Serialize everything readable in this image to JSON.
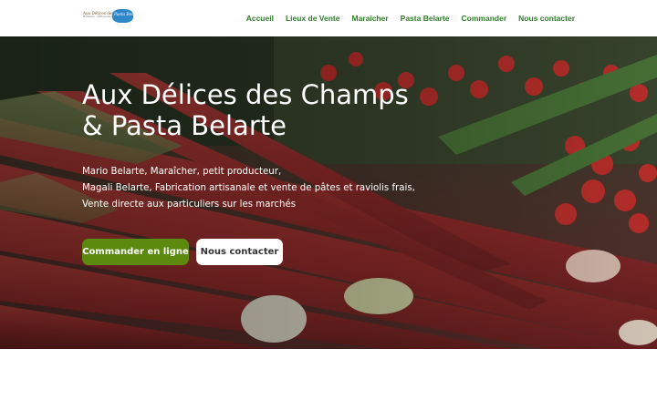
{
  "logo": {
    "line1": "Aux Délices des Champs",
    "line2": "Maraîcher – Petit producteur",
    "badge": "Pasta Belarte"
  },
  "nav": {
    "items": [
      {
        "label": "Accueil"
      },
      {
        "label": "Lieux de Vente"
      },
      {
        "label": "Maraîcher"
      },
      {
        "label": "Pasta Belarte"
      },
      {
        "label": "Commander"
      },
      {
        "label": "Nous contacter"
      }
    ]
  },
  "hero": {
    "title_line1": "Aux Délices des Champs",
    "title_line2": "& Pasta Belarte",
    "desc_line1": "Mario Belarte, Maraîcher, petit producteur,",
    "desc_line2": "Magali Belarte, Fabrication artisanale et vente de pâtes et raviolis frais,",
    "desc_line3": "Vente directe aux particuliers sur les marchés",
    "btn_order": "Commander en ligne",
    "btn_contact": "Nous contacter"
  },
  "colors": {
    "nav_text": "#2f7d2a",
    "primary_button": "#5b8a0e",
    "secondary_button": "#ffffff"
  }
}
